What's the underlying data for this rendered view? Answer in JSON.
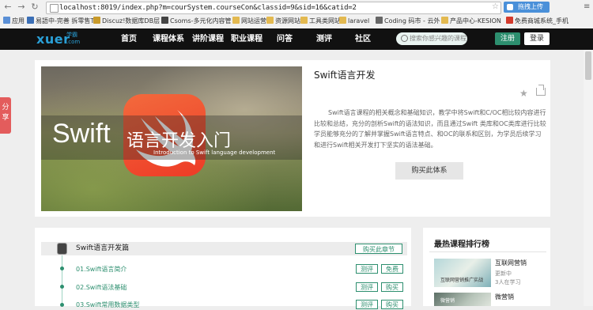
{
  "browser": {
    "url": "localhost:8019/index.php?m=courSystem.courseCon&classid=9&sid=16&catid=2",
    "upload_label": "拖拽上传",
    "bookmarks": [
      {
        "label": "应用",
        "color": "#5a8fd6"
      },
      {
        "label": "易語中-完善 拆零售T",
        "color": "#3b6fb6"
      },
      {
        "label": "Discuz!数据库DB层 -",
        "color": "#c89a2a"
      },
      {
        "label": "Csoms-多元化内容管",
        "color": "#444444"
      },
      {
        "label": "网站运营",
        "color": "#e3b950"
      },
      {
        "label": "资源网站",
        "color": "#e3b950"
      },
      {
        "label": "工具类网站",
        "color": "#e3b950"
      },
      {
        "label": "laravel",
        "color": "#e3b950"
      },
      {
        "label": "Coding 码市 - 云外",
        "color": "#666666"
      },
      {
        "label": "产品中心-KESION",
        "color": "#e3b950"
      },
      {
        "label": "免费商城系统_手机",
        "color": "#d33a2c"
      }
    ]
  },
  "header": {
    "logo_text": "xuer",
    "logo_cn": "学霸",
    "logo_com": ".com",
    "nav": [
      "首页",
      "课程体系",
      "讲阶课程",
      "职业课程",
      "问答",
      "测评",
      "社区"
    ],
    "search_placeholder": "搜索你感兴趣的课程",
    "register": "注册",
    "login": "登录"
  },
  "share_tab": "分享",
  "course": {
    "banner_title": "Swift",
    "banner_cn": "语言开发入门",
    "banner_en": "Introduction to Swift language development",
    "title": "Swift语言开发",
    "description": "Swift语言课程的相关概念和基础知识，教学中将Swift和C/OC相比较内容进行比较和总结，充分的剖析Swift的语法知识，而且通过Swift 类库和OC类库进行比较学员能够充分的了解并掌握Swift语言特点、和OC的联系和区别，为学员后续学习和进行Swift相关开发打下坚实的语法基础。",
    "buy_system": "购买此体系"
  },
  "chapter": {
    "title": "Swift语言开发篇",
    "buy_chapter": "购买此章节",
    "lessons": [
      {
        "title": "01.Swift语言简介",
        "eval": "测评",
        "action": "免费"
      },
      {
        "title": "02.Swift语法基础",
        "eval": "测评",
        "action": "购买"
      },
      {
        "title": "03.Swift常用数据类型",
        "eval": "测评",
        "action": "购买"
      }
    ]
  },
  "ranking": {
    "title": "最热课程排行榜",
    "items": [
      {
        "name": "互联网营销",
        "sub1": "更新中",
        "sub2": "3人在学习",
        "thumb_text": "互联网营销推广实战"
      },
      {
        "name": "微营销",
        "sub1": "",
        "sub2": "",
        "thumb_text": "微营销"
      }
    ]
  }
}
